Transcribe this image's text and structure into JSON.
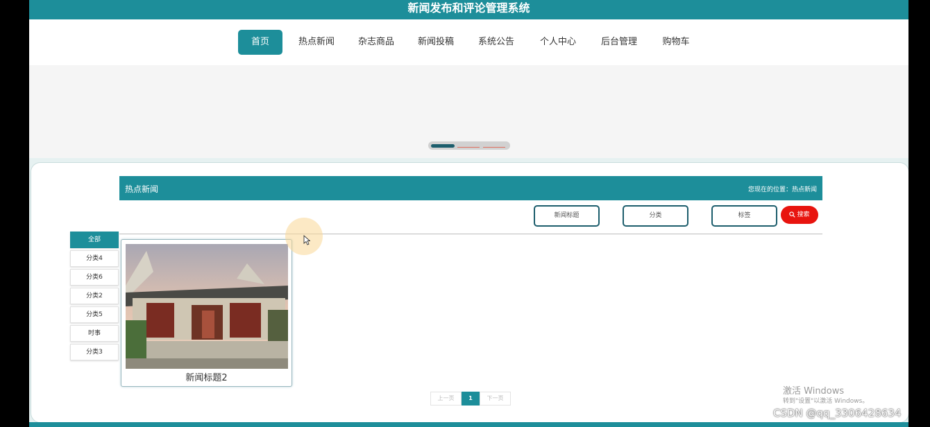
{
  "app": {
    "title": "新闻发布和评论管理系统"
  },
  "nav": {
    "items": [
      {
        "label": "首页",
        "active": true
      },
      {
        "label": "热点新闻",
        "active": false
      },
      {
        "label": "杂志商品",
        "active": false
      },
      {
        "label": "新闻投稿",
        "active": false
      },
      {
        "label": "系统公告",
        "active": false
      },
      {
        "label": "个人中心",
        "active": false
      },
      {
        "label": "后台管理",
        "active": false
      },
      {
        "label": "购物车",
        "active": false
      }
    ]
  },
  "section": {
    "title": "热点新闻",
    "breadcrumb": "您现在的位置：热点新闻"
  },
  "filters": {
    "title_field": "新闻标题",
    "category_field": "分类",
    "tag_field": "标签",
    "search_label": "搜索"
  },
  "categories": [
    "全部",
    "分类4",
    "分类6",
    "分类2",
    "分类5",
    "时事",
    "分类3"
  ],
  "news": [
    {
      "title": "新闻标题2"
    }
  ],
  "pagination": {
    "prev": "上一页",
    "current": "1",
    "next": "下一页"
  },
  "watermark": {
    "line1": "激活 Windows",
    "line2": "转到\"设置\"以激活 Windows。",
    "csdn": "CSDN @qq_3306428634"
  },
  "colors": {
    "accent": "#1d8e9a",
    "search": "#e8140f"
  }
}
